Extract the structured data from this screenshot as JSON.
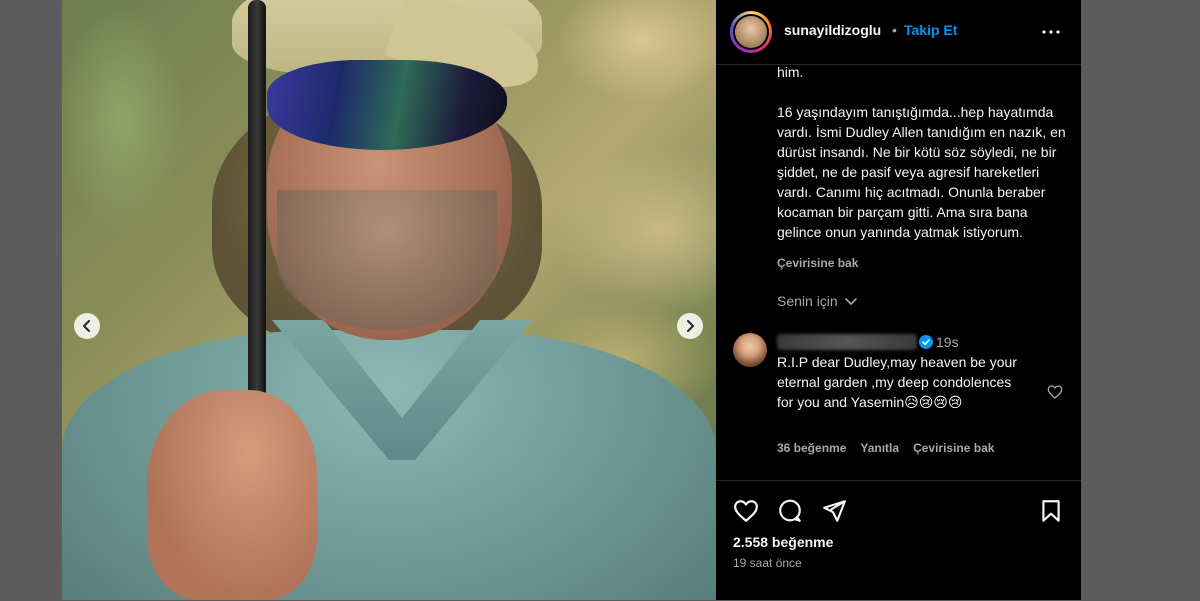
{
  "post": {
    "arrow_prev_label": "‹",
    "arrow_next_label": "›"
  },
  "header": {
    "username": "sunayildizoglu",
    "separator": "•",
    "follow_label": "Takip Et",
    "more_icon": "more-horizontal-icon"
  },
  "caption": {
    "line_prev": "him.",
    "body": "16 yaşındayım tanıştığımda...hep hayatımda vardı. İsmi Dudley Allen tanıdığım en nazık, en dürüst insandı. Ne bir kötü söz söyledi, ne bir şiddet, ne de pasif veya agresif hareketleri vardı. Canımı hiç acıtmadı. Onunla beraber kocaman bir parçam gitti. Ama sıra bana gelince onun yanında yatmak istiyorum.",
    "see_translation": "Çevirisine bak",
    "for_you": "Senin için"
  },
  "comment": {
    "time": "19s",
    "text": "R.I.P dear Dudley,may heaven be your eternal garden ,my deep condolences for you and Yasemin😥😢😢😢",
    "likes": "36 beğenme",
    "reply": "Yanıtla",
    "see_translation": "Çevirisine bak"
  },
  "actions": {
    "likes": "2.558 beğenme",
    "time_ago": "19 saat önce"
  },
  "colors": {
    "accent": "#0095f6",
    "panel_bg": "#000000",
    "muted_text": "#a8a8a8"
  }
}
